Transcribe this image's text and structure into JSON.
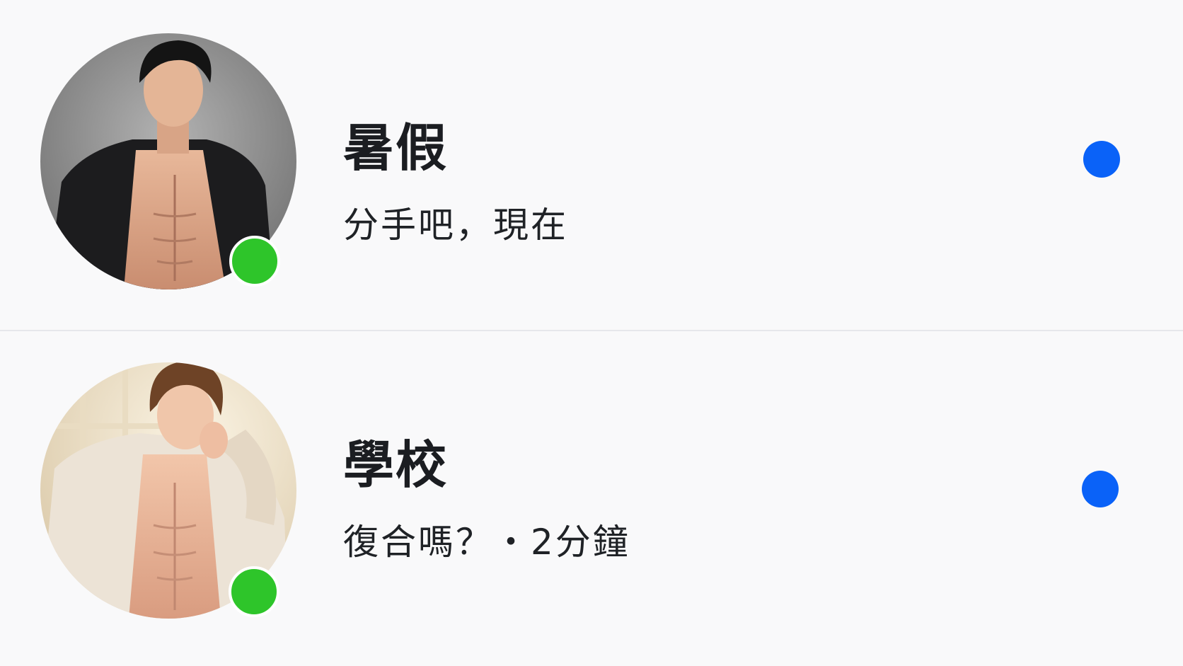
{
  "colors": {
    "background": "#f9f9fa",
    "divider": "#e6e7eb",
    "online_status": "#2ec52a",
    "unread_indicator": "#0a62f8",
    "name_text": "#1b1d21",
    "preview_text": "#1f2226"
  },
  "conversations": [
    {
      "name": "暑假",
      "preview": "分手吧，現在",
      "online": true,
      "unread": true
    },
    {
      "name": "學校",
      "preview": "復合嗎？・2分鐘",
      "online": true,
      "unread": true
    }
  ]
}
